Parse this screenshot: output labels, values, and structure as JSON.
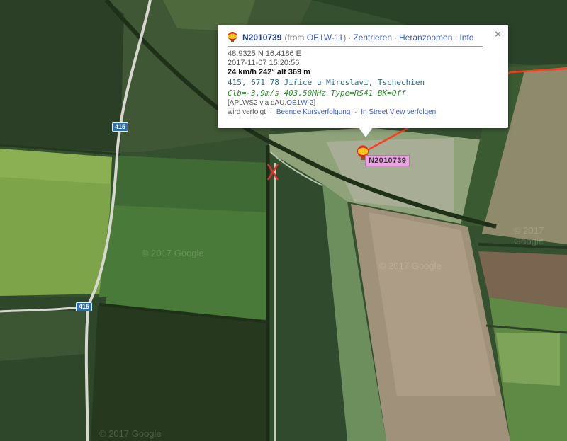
{
  "map": {
    "road_labels": [
      {
        "text": "415"
      },
      {
        "text": "415"
      }
    ],
    "watermarks": [
      "© 2017 Google",
      "© 2017 Google",
      "© 2017 Google",
      "© 2017 Google"
    ],
    "colors": {
      "track": "#ff3b1e",
      "x_marker": "#e03030",
      "label_bg": "#e9a3e0"
    }
  },
  "marker": {
    "label": "N2010739",
    "icon": "balloon-icon"
  },
  "popup": {
    "callsign": "N2010739",
    "from_prefix": "(from ",
    "from_station": "OE1W-11",
    "from_suffix": ")",
    "link_center": "Zentrieren",
    "link_zoom": "Heranzoomen",
    "link_info": "Info",
    "separator": "·",
    "coords": "48.9325 N 16.4186 E",
    "timestamp": "2017-11-07 15:20:56",
    "speed_line": "24 km/h 242° alt 369 m",
    "address": "415, 671 78 Jiřice u Miroslavi, Tschechien",
    "comment": "Clb=-3.9m/s 403.50MHz Type=RS41 BK=Off",
    "path_prefix": "[APLWS2 via qAU,",
    "path_link": "OE1W-2",
    "path_suffix": "]",
    "tracked_text": "wird verfolgt",
    "link_stop_tracking": "Beende Kursverfolgung",
    "link_streetview": "In Street View verfolgen",
    "close_symbol": "×"
  }
}
